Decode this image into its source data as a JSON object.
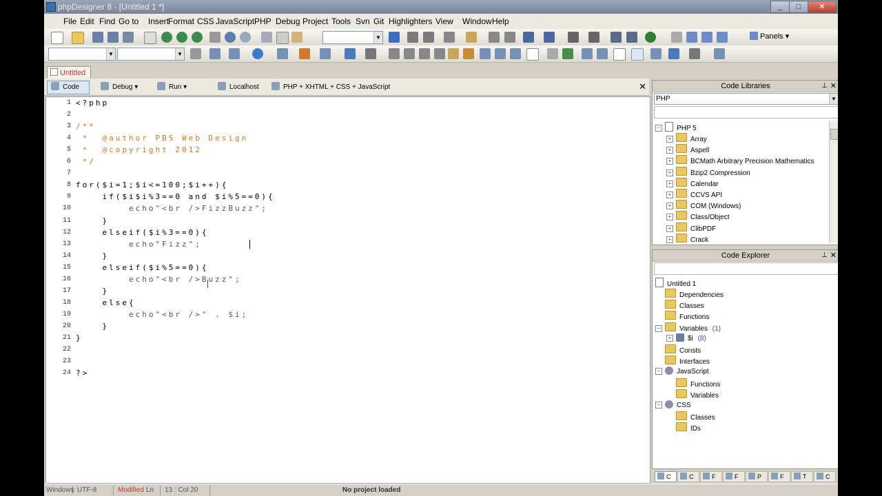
{
  "window": {
    "title": "phpDesigner 8 - [Untitled 1 *]",
    "minimize": "_",
    "maximize": "□",
    "close": "✕"
  },
  "menu": [
    "File",
    "Edit",
    "Find",
    "Go to",
    "Insert",
    "Format",
    "CSS",
    "JavaScript",
    "PHP",
    "Debug",
    "Project",
    "Tools",
    "Svn",
    "Git",
    "Highlighters",
    "View",
    "Window",
    "Help"
  ],
  "toolbar2": {
    "panels_label": "Panels"
  },
  "doc_tab": {
    "label": "Untitled 1"
  },
  "editor_toolbar": [
    {
      "label": "Code",
      "active": true
    },
    {
      "label": "Debug",
      "active": false
    },
    {
      "label": "Run",
      "active": false
    },
    {
      "label": "Localhost",
      "active": false
    },
    {
      "label": "PHP + XHTML + CSS + JavaScript",
      "active": false
    }
  ],
  "code_lines": [
    {
      "n": "1",
      "text": "<?php",
      "kind": "kw"
    },
    {
      "n": "2",
      "text": "",
      "kind": "kw"
    },
    {
      "n": "3",
      "text": "/**",
      "kind": "cm"
    },
    {
      "n": "4",
      "text": " *  @author PBS Web Design",
      "kind": "cm"
    },
    {
      "n": "5",
      "text": " *  @copyright 2012",
      "kind": "cm"
    },
    {
      "n": "6",
      "text": " */",
      "kind": "cm"
    },
    {
      "n": "7",
      "text": "",
      "kind": "kw"
    },
    {
      "n": "8",
      "text": "for($i=1;$i<=100;$i++){",
      "kind": "kw"
    },
    {
      "n": "9",
      "text": "    if($i$i%3==0 and $i%5==0){",
      "kind": "kw"
    },
    {
      "n": "10",
      "text": "        echo\"<br />FizzBuzz\";",
      "kind": "str"
    },
    {
      "n": "11",
      "text": "    }",
      "kind": "kw"
    },
    {
      "n": "12",
      "text": "    elseif($i%3==0){",
      "kind": "kw"
    },
    {
      "n": "13",
      "text": "        echo\"Fizz\";",
      "kind": "str"
    },
    {
      "n": "14",
      "text": "    }",
      "kind": "kw"
    },
    {
      "n": "15",
      "text": "    elseif($i%5==0){",
      "kind": "kw"
    },
    {
      "n": "16",
      "text": "        echo\"<br />Buzz\";",
      "kind": "str"
    },
    {
      "n": "17",
      "text": "    }",
      "kind": "kw"
    },
    {
      "n": "18",
      "text": "    else{",
      "kind": "kw"
    },
    {
      "n": "19",
      "text": "        echo\"<br />\" . $i;",
      "kind": "str"
    },
    {
      "n": "20",
      "text": "    }",
      "kind": "kw"
    },
    {
      "n": "21",
      "text": "}",
      "kind": "kw"
    },
    {
      "n": "22",
      "text": "",
      "kind": "kw"
    },
    {
      "n": "23",
      "text": "",
      "kind": "kw"
    },
    {
      "n": "24",
      "text": "?>",
      "kind": "kw"
    }
  ],
  "code_libraries": {
    "title": "Code Libraries",
    "selected": "PHP",
    "root": "PHP 5",
    "items": [
      "Array",
      "Aspell",
      "BCMath Arbitrary Precision Mathematics",
      "Bzip2 Compression",
      "Calendar",
      "CCVS API",
      "COM (Windows)",
      "Class/Object",
      "ClibPDF",
      "Crack"
    ]
  },
  "code_explorer": {
    "title": "Code Explorer",
    "root": "Untitled 1",
    "items": [
      {
        "label": "Dependencies",
        "indent": 1,
        "icon": "folder",
        "exp": ""
      },
      {
        "label": "Classes",
        "indent": 1,
        "icon": "folder",
        "exp": ""
      },
      {
        "label": "Functions",
        "indent": 1,
        "icon": "folder",
        "exp": ""
      },
      {
        "label": "Variables",
        "count": "(1)",
        "indent": 1,
        "icon": "folder",
        "exp": "−"
      },
      {
        "label": "$i",
        "count": "(8)",
        "indent": 2,
        "icon": "var",
        "exp": "+"
      },
      {
        "label": "Consts",
        "indent": 1,
        "icon": "folder",
        "exp": ""
      },
      {
        "label": "Interfaces",
        "indent": 1,
        "icon": "folder",
        "exp": ""
      },
      {
        "label": "JavaScript",
        "indent": 1,
        "icon": "gear",
        "exp": "−"
      },
      {
        "label": "Functions",
        "indent": 2,
        "icon": "folder",
        "exp": ""
      },
      {
        "label": "Variables",
        "indent": 2,
        "icon": "folder",
        "exp": ""
      },
      {
        "label": "CSS",
        "indent": 1,
        "icon": "gear",
        "exp": "−"
      },
      {
        "label": "Classes",
        "indent": 2,
        "icon": "folder",
        "exp": ""
      },
      {
        "label": "IDs",
        "indent": 2,
        "icon": "folder",
        "exp": ""
      }
    ]
  },
  "bottom_tabs": [
    "C",
    "C",
    "F",
    "F",
    "P",
    "F",
    "T",
    "C"
  ],
  "status": {
    "os": "Windows",
    "encoding": "UTF-8",
    "modified": "Modified",
    "line": "Ln",
    "pos": "13 : Col 20",
    "project": "No project loaded"
  },
  "colors": {
    "comment": "#c77b20",
    "modified": "#c0392b"
  }
}
